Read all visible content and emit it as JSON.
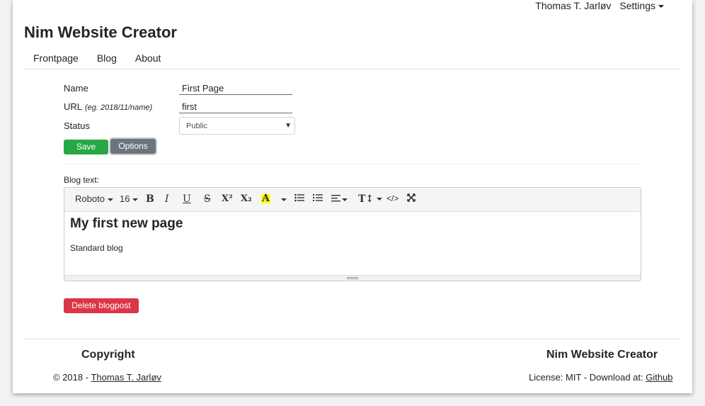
{
  "topbar": {
    "user": "Thomas T. Jarløv",
    "settings": "Settings"
  },
  "site_title": "Nim Website Creator",
  "nav": [
    "Frontpage",
    "Blog",
    "About"
  ],
  "form": {
    "name_label": "Name",
    "name_value": "First Page",
    "url_label": "URL",
    "url_hint": "(eg. 2018/11/name)",
    "url_value": "first",
    "status_label": "Status",
    "status_value": "Public",
    "save_label": "Save",
    "options_label": "Options"
  },
  "editor": {
    "label": "Blog text:",
    "toolbar": {
      "font": "Roboto",
      "size": "16",
      "bold": "B",
      "italic": "I",
      "underline": "U",
      "strike": "S",
      "superscript": "X²",
      "subscript": "X₂",
      "color": "A",
      "code": "</>"
    },
    "heading": "My first new page",
    "body": "Standard blog"
  },
  "delete_label": "Delete blogpost",
  "footer": {
    "left_heading": "Copyright",
    "left_text": "© 2018 - ",
    "left_link": "Thomas T. Jarløv",
    "right_heading": "Nim Website Creator",
    "right_text": "License: MIT - Download at: ",
    "right_link": "Github"
  },
  "colors": {
    "save": "#28a745",
    "options": "#6c757d",
    "delete": "#dc3545",
    "highlight": "#ffff00"
  }
}
